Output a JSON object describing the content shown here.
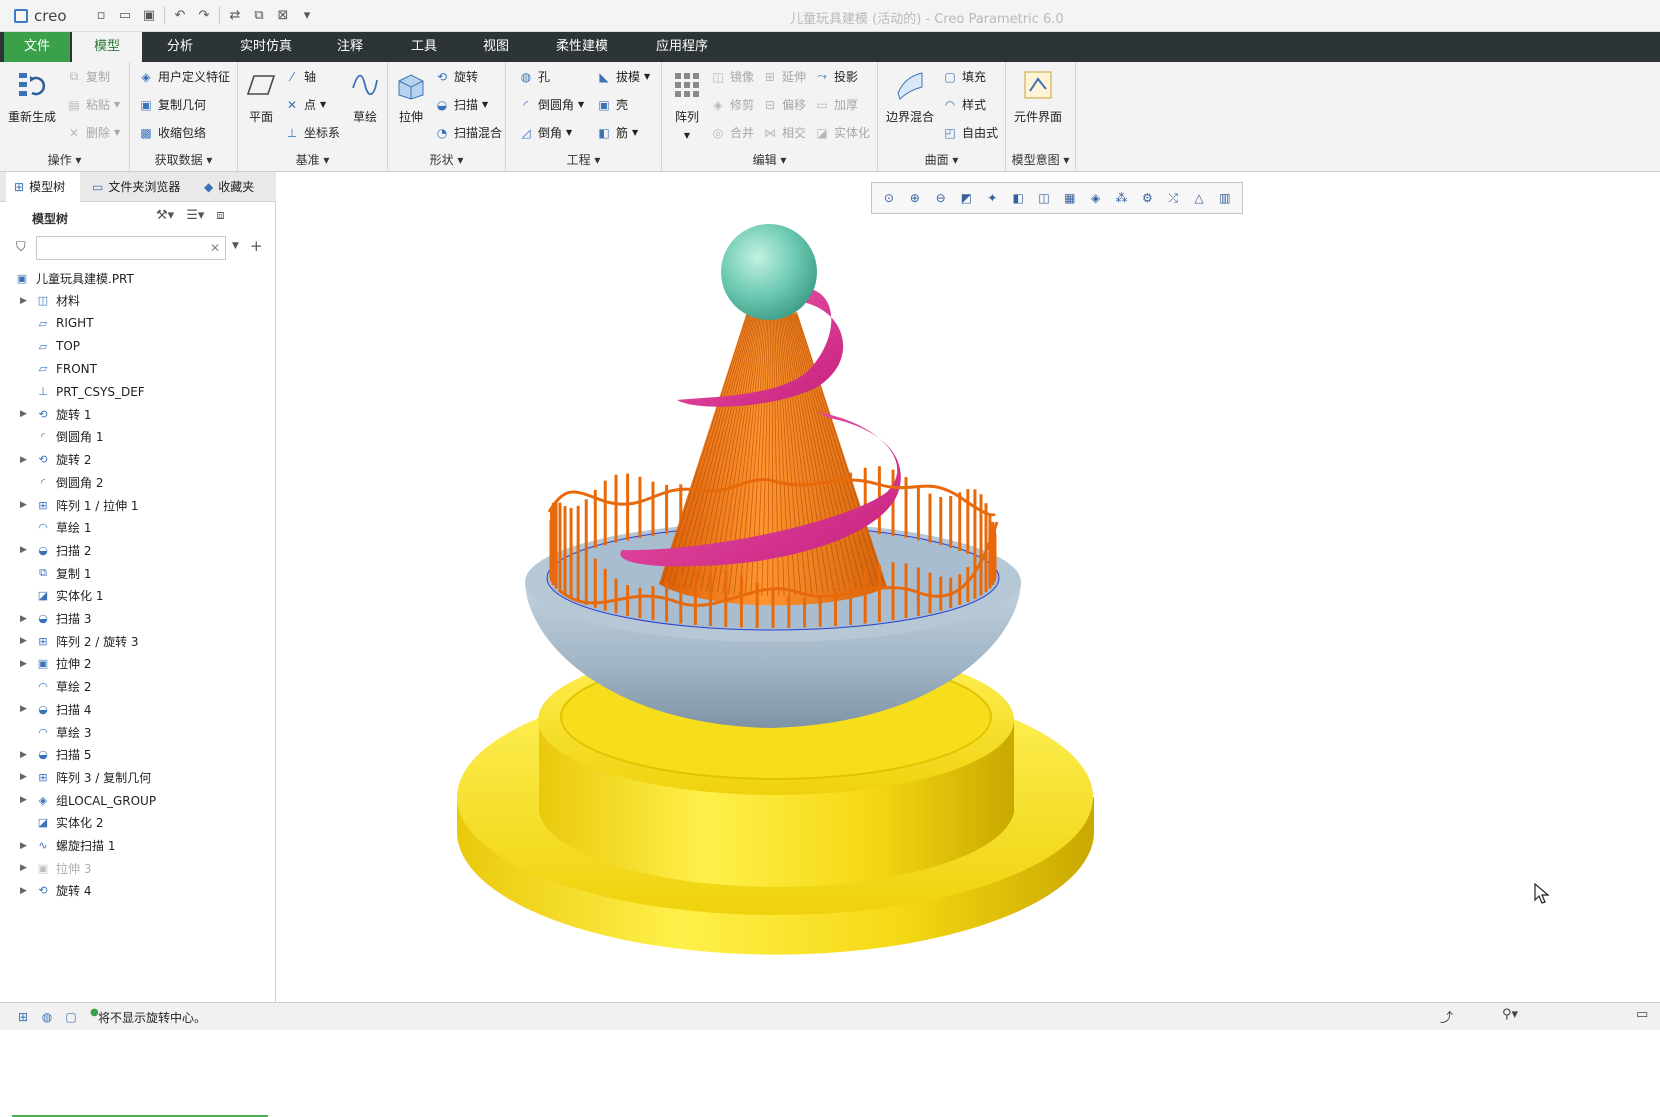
{
  "app": {
    "logo_text": "creo",
    "window_title": "儿童玩具建模 (活动的) - Creo Parametric 6.0"
  },
  "quick_access": [
    "new-icon",
    "open-icon",
    "save-icon",
    "undo-icon",
    "redo-icon",
    "regenerate-icon",
    "windows-icon",
    "close-window-icon",
    "customize-icon"
  ],
  "menu": {
    "tabs": [
      {
        "label": "文件"
      },
      {
        "label": "模型"
      },
      {
        "label": "分析"
      },
      {
        "label": "实时仿真"
      },
      {
        "label": "注释"
      },
      {
        "label": "工具"
      },
      {
        "label": "视图"
      },
      {
        "label": "柔性建模"
      },
      {
        "label": "应用程序"
      }
    ],
    "active_index": 1
  },
  "ribbon": {
    "operations": {
      "label": "操作",
      "regenerate": "重新生成",
      "copy": "复制",
      "paste": "粘贴",
      "delete": "删除"
    },
    "get_data": {
      "label": "获取数据",
      "udf": "用户定义特征",
      "copy_geom": "复制几何",
      "shrinkwrap": "收缩包络"
    },
    "datum": {
      "label": "基准",
      "plane": "平面",
      "axis": "轴",
      "point": "点",
      "csys": "坐标系",
      "sketch": "草绘"
    },
    "shapes": {
      "label": "形状",
      "extrude": "拉伸",
      "revolve": "旋转",
      "sweep": "扫描",
      "swept_blend": "扫描混合"
    },
    "engineering": {
      "label": "工程",
      "hole": "孔",
      "draft": "拔模",
      "round": "倒圆角",
      "shell": "壳",
      "chamfer": "倒角",
      "rib": "筋"
    },
    "editing": {
      "label": "编辑",
      "pattern": "阵列",
      "mirror": "镜像",
      "extend": "延伸",
      "project": "投影",
      "trim": "修剪",
      "offset": "偏移",
      "thicken": "加厚",
      "merge": "合并",
      "intersect": "相交",
      "solidify": "实体化"
    },
    "surfaces": {
      "label": "曲面",
      "boundary_blend": "边界混合",
      "fill": "填充",
      "style": "样式",
      "freestyle": "自由式"
    },
    "model_intent": {
      "label": "模型意图",
      "component_interface": "元件界面"
    }
  },
  "left_panel": {
    "tabs": [
      {
        "label": "模型树"
      },
      {
        "label": "文件夹浏览器"
      },
      {
        "label": "收藏夹"
      }
    ],
    "tree_title": "模型树",
    "search_placeholder": "",
    "root": "儿童玩具建模.PRT",
    "items": [
      {
        "label": "材料",
        "expandable": true,
        "icon": "material-icon",
        "muted": false
      },
      {
        "label": "RIGHT",
        "expandable": false,
        "icon": "datum-plane-icon",
        "muted": false
      },
      {
        "label": "TOP",
        "expandable": false,
        "icon": "datum-plane-icon",
        "muted": false
      },
      {
        "label": "FRONT",
        "expandable": false,
        "icon": "datum-plane-icon",
        "muted": false
      },
      {
        "label": "PRT_CSYS_DEF",
        "expandable": false,
        "icon": "csys-icon",
        "muted": false
      },
      {
        "label": "旋转 1",
        "expandable": true,
        "icon": "revolve-icon",
        "muted": false
      },
      {
        "label": "倒圆角 1",
        "expandable": false,
        "icon": "round-icon",
        "muted": false
      },
      {
        "label": "旋转 2",
        "expandable": true,
        "icon": "revolve-icon",
        "muted": false
      },
      {
        "label": "倒圆角 2",
        "expandable": false,
        "icon": "round-icon",
        "muted": false
      },
      {
        "label": "阵列 1 / 拉伸 1",
        "expandable": true,
        "icon": "pattern-icon",
        "muted": false
      },
      {
        "label": "草绘 1",
        "expandable": false,
        "icon": "sketch-icon",
        "muted": false
      },
      {
        "label": "扫描 2",
        "expandable": true,
        "icon": "sweep-icon",
        "muted": false
      },
      {
        "label": "复制 1",
        "expandable": false,
        "icon": "copy-icon",
        "muted": false
      },
      {
        "label": "实体化 1",
        "expandable": false,
        "icon": "solidify-icon",
        "muted": false
      },
      {
        "label": "扫描 3",
        "expandable": true,
        "icon": "sweep-icon",
        "muted": false
      },
      {
        "label": "阵列 2 / 旋转 3",
        "expandable": true,
        "icon": "pattern-icon",
        "muted": false
      },
      {
        "label": "拉伸 2",
        "expandable": true,
        "icon": "extrude-icon",
        "muted": false
      },
      {
        "label": "草绘 2",
        "expandable": false,
        "icon": "sketch-icon",
        "muted": false
      },
      {
        "label": "扫描 4",
        "expandable": true,
        "icon": "sweep-icon",
        "muted": false
      },
      {
        "label": "草绘 3",
        "expandable": false,
        "icon": "sketch-icon",
        "muted": false
      },
      {
        "label": "扫描 5",
        "expandable": true,
        "icon": "sweep-icon",
        "muted": false
      },
      {
        "label": "阵列 3 / 复制几何",
        "expandable": true,
        "icon": "pattern-icon",
        "muted": false
      },
      {
        "label": "组LOCAL_GROUP",
        "expandable": true,
        "icon": "group-icon",
        "muted": false
      },
      {
        "label": "实体化 2",
        "expandable": false,
        "icon": "solidify-icon",
        "muted": false
      },
      {
        "label": "螺旋扫描 1",
        "expandable": true,
        "icon": "helical-sweep-icon",
        "muted": false
      },
      {
        "label": "拉伸 3",
        "expandable": true,
        "icon": "extrude-icon",
        "muted": true
      },
      {
        "label": "旋转 4",
        "expandable": true,
        "icon": "revolve-icon",
        "muted": false
      }
    ]
  },
  "view_toolbar": [
    "refit-icon",
    "zoom-in-icon",
    "zoom-out-icon",
    "repaint-icon",
    "spin-center-icon",
    "display-style-icon",
    "saved-orientations-icon",
    "view-manager-icon",
    "perspective-icon",
    "datum-display-icon",
    "annotation-display-icon",
    "spin-toggle-icon",
    "appearance-icon",
    "sketch-view-icon"
  ],
  "model_colors": {
    "base": "#f2dc16",
    "bowl": "#a9bccb",
    "cone": "#f07a12",
    "spiral": "#e0308f",
    "ball": "#6fcbb4",
    "rail": "#e8690a"
  },
  "status": {
    "message": "将不显示旋转中心。"
  }
}
